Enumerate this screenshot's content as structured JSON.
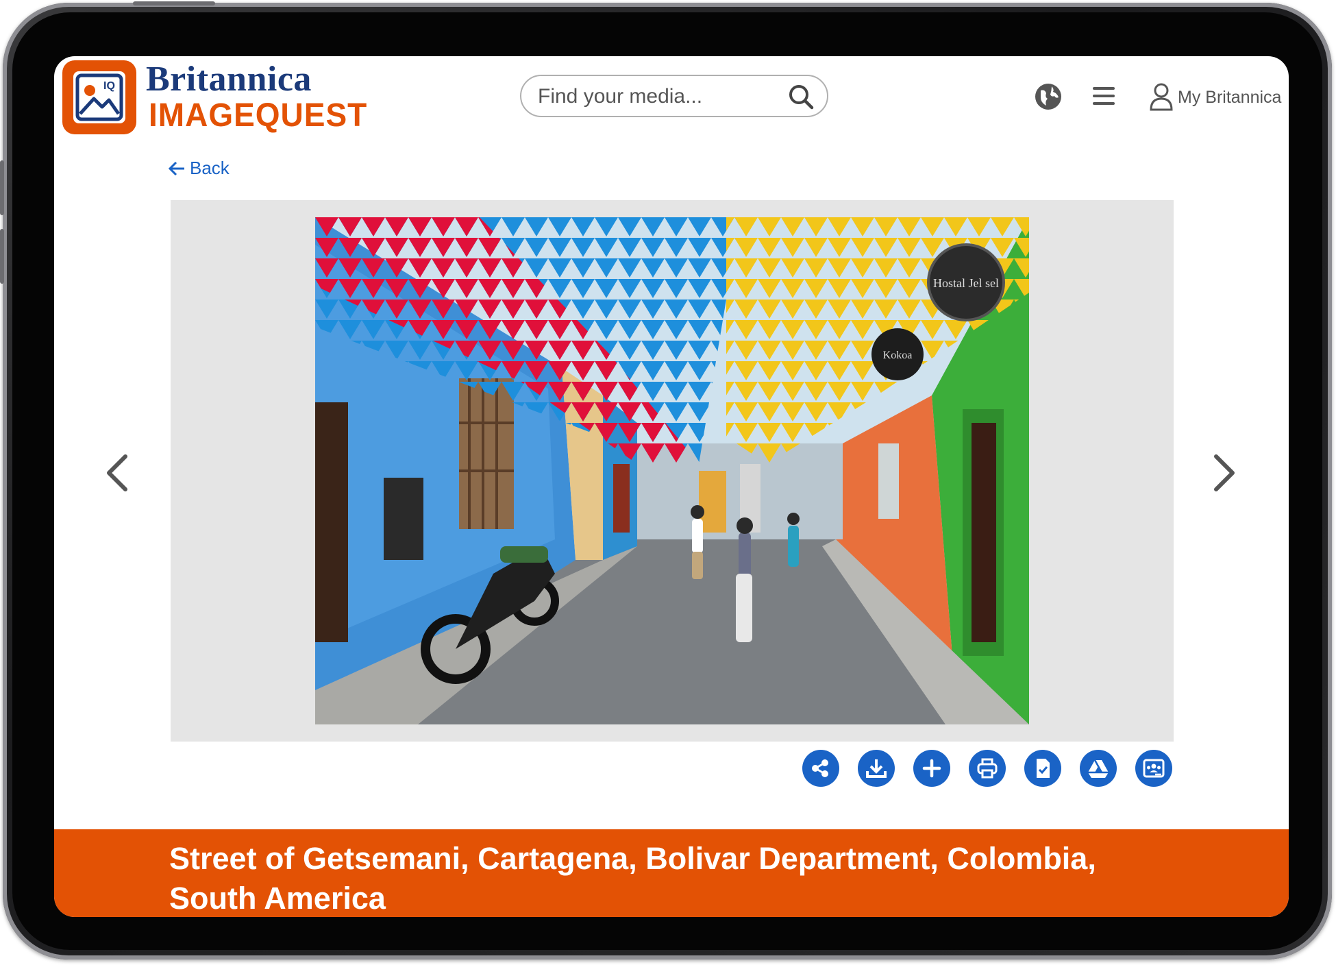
{
  "brand": {
    "name_top": "Britannica",
    "name_bottom": "IMAGEQUEST",
    "badge_text": "IQ",
    "accent_color": "#e35205",
    "primary_color": "#1a63c6"
  },
  "header": {
    "search_placeholder": "Find your media...",
    "account_label": "My Britannica",
    "icons": [
      "globe-icon",
      "menu-icon",
      "user-icon",
      "search-icon"
    ]
  },
  "nav": {
    "back_label": "Back"
  },
  "viewer": {
    "image_alt": "Street of Getsemani, Cartagena, Bolivar Department, Colombia, South America",
    "sign_text": "Hostal Jel sel",
    "sign2_text": "Kokoa"
  },
  "toolbar": {
    "actions": [
      "share",
      "download",
      "add",
      "print",
      "cite",
      "google-drive",
      "google-classroom"
    ]
  },
  "caption": {
    "title": "Street of Getsemani, Cartagena, Bolivar Department, Colombia, South America"
  }
}
